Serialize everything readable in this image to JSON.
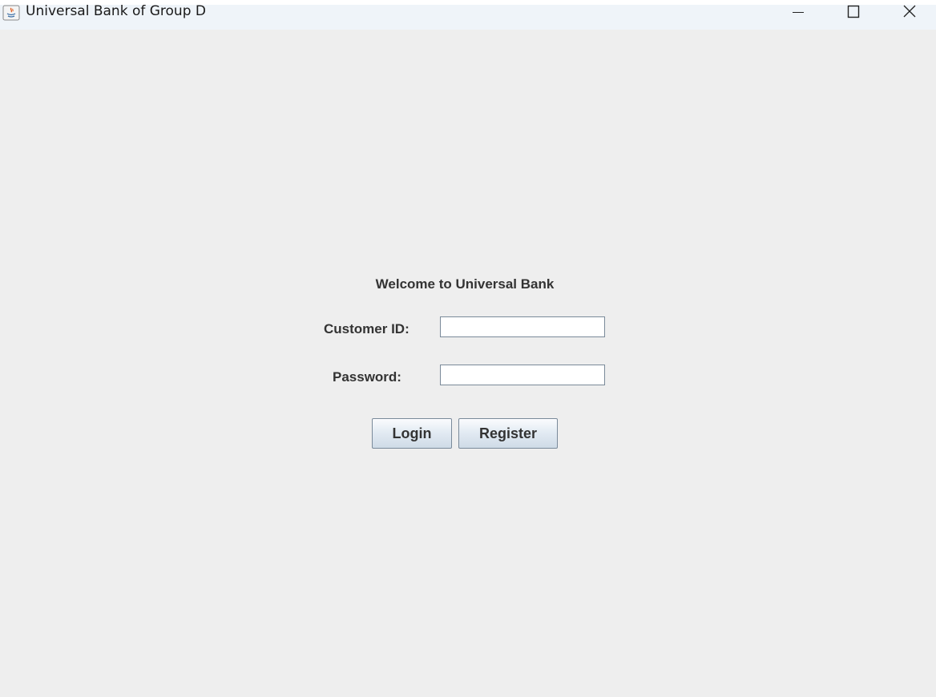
{
  "window": {
    "title": "Universal Bank of Group D",
    "controls": {
      "minimize": "minimize-icon",
      "maximize": "maximize-icon",
      "close": "close-icon"
    }
  },
  "login": {
    "heading": "Welcome to Universal Bank",
    "customer_id_label": "Customer ID:",
    "customer_id_value": "",
    "password_label": "Password:",
    "password_value": "",
    "login_button": "Login",
    "register_button": "Register"
  },
  "colors": {
    "background": "#eeeeee",
    "titlebar": "#eff4f9",
    "text": "#333333"
  }
}
